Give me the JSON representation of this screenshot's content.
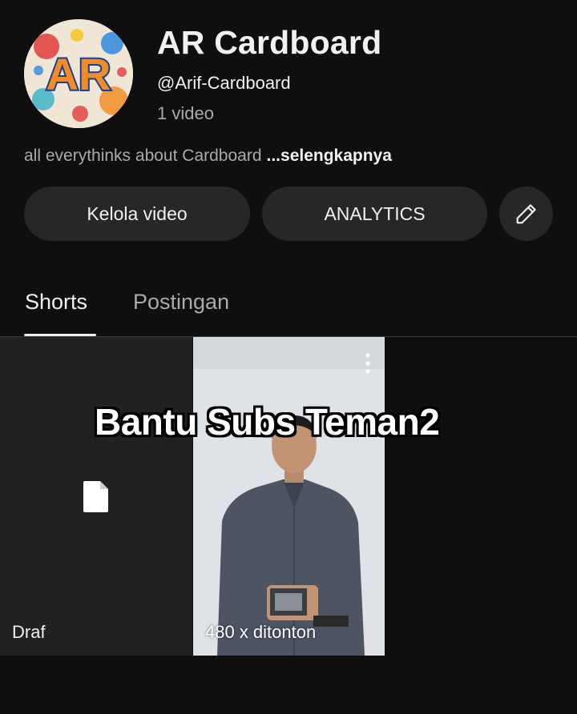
{
  "channel": {
    "name": "AR Cardboard",
    "handle": "@Arif-Cardboard",
    "video_count": "1 video",
    "description": "all everythinks about Cardboard",
    "more_label": "...selengkapnya",
    "avatar_text": "AR",
    "icon": "channel-avatar-logo"
  },
  "actions": {
    "manage_label": "Kelola video",
    "analytics_label": "ANALYTICS",
    "edit_icon": "pencil-icon"
  },
  "tabs": [
    {
      "label": "Shorts",
      "active": true
    },
    {
      "label": "Postingan",
      "active": false
    }
  ],
  "shorts": [
    {
      "type": "draft",
      "label": "Draf",
      "icon": "document-icon"
    },
    {
      "type": "video",
      "views": "480 x ditonton",
      "menu_icon": "more-vert-icon"
    }
  ],
  "overlay_caption": "Bantu Subs Teman2",
  "colors": {
    "background": "#0f0f0f",
    "button": "#272727",
    "text_primary": "#f1f1f1",
    "text_secondary": "#aaaaaa"
  }
}
